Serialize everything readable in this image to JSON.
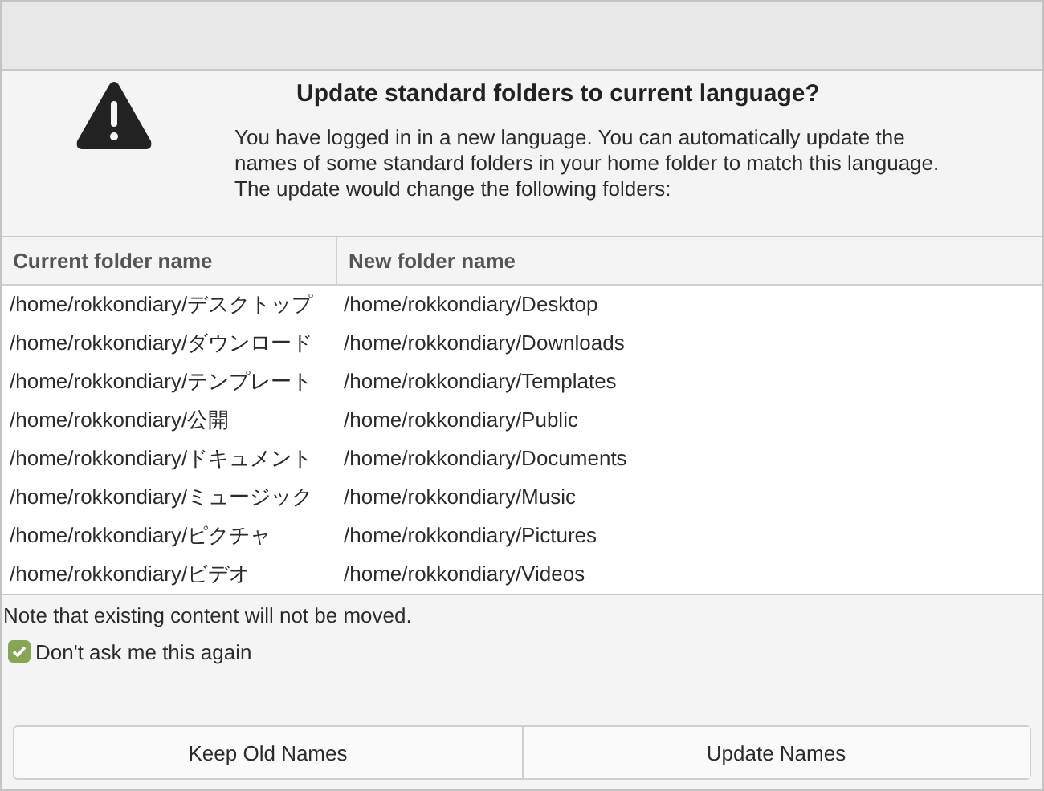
{
  "heading": "Update standard folders to current language?",
  "message": "You have logged in in a new language. You can automatically update the names of some standard folders in your home folder to match this language. The update would change the following folders:",
  "table": {
    "columns": [
      "Current folder name",
      "New folder name"
    ],
    "rows": [
      [
        "/home/rokkondiary/デスクトップ",
        "/home/rokkondiary/Desktop"
      ],
      [
        "/home/rokkondiary/ダウンロード",
        "/home/rokkondiary/Downloads"
      ],
      [
        "/home/rokkondiary/テンプレート",
        "/home/rokkondiary/Templates"
      ],
      [
        "/home/rokkondiary/公開",
        "/home/rokkondiary/Public"
      ],
      [
        "/home/rokkondiary/ドキュメント",
        "/home/rokkondiary/Documents"
      ],
      [
        "/home/rokkondiary/ミュージック",
        "/home/rokkondiary/Music"
      ],
      [
        "/home/rokkondiary/ピクチャ",
        "/home/rokkondiary/Pictures"
      ],
      [
        "/home/rokkondiary/ビデオ",
        "/home/rokkondiary/Videos"
      ]
    ]
  },
  "note": "Note that existing content will not be moved.",
  "checkbox": {
    "label": "Don't ask me this again",
    "checked": true
  },
  "buttons": [
    "Keep Old Names",
    "Update Names"
  ]
}
